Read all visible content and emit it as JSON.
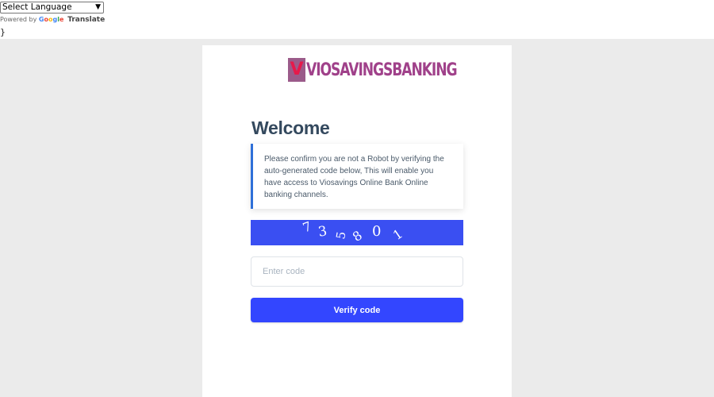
{
  "translate": {
    "select_label": "Select Language",
    "powered_by": "Powered by",
    "google_letters": [
      "G",
      "o",
      "o",
      "g",
      "l",
      "e"
    ],
    "translate_label": "Translate",
    "stray_text": "}"
  },
  "brand": {
    "name": "VIOSAVINGSBANKING",
    "logo_letter": "V",
    "color": "#a0418a"
  },
  "main": {
    "heading": "Welcome",
    "notice": "Please confirm you are not a Robot by verifying the auto-generated code below, This will enable you have access to Viosavings Online Bank Online banking channels.",
    "notice_accent": "#2f70d8",
    "captcha": {
      "chars": [
        "7",
        "3",
        "5",
        "8",
        "0",
        "1"
      ],
      "background": "#3a4ff2"
    },
    "code_input": {
      "value": "",
      "placeholder": "Enter code"
    },
    "verify_label": "Verify code",
    "button_color": "#3346ff"
  }
}
